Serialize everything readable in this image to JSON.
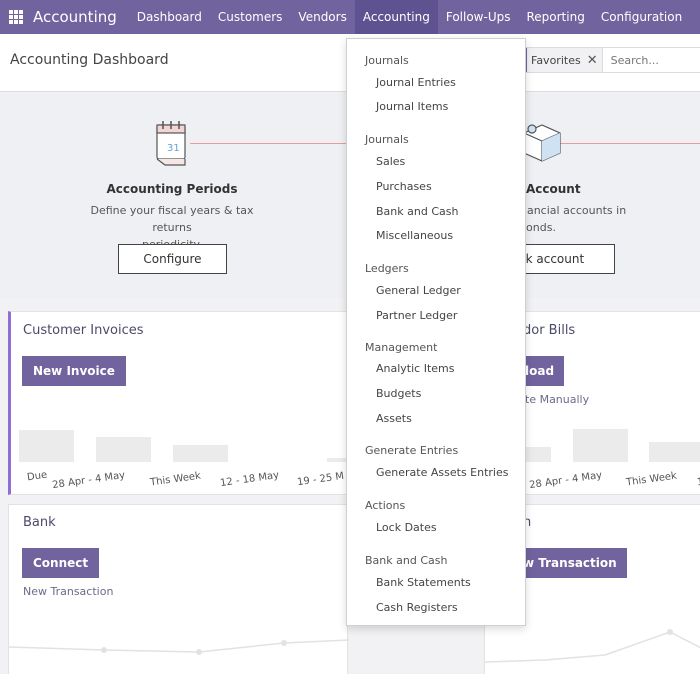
{
  "navbar": {
    "brand": "Accounting",
    "items": [
      {
        "label": "Dashboard"
      },
      {
        "label": "Customers"
      },
      {
        "label": "Vendors"
      },
      {
        "label": "Accounting"
      },
      {
        "label": "Follow-Ups"
      },
      {
        "label": "Reporting"
      },
      {
        "label": "Configuration"
      }
    ]
  },
  "control_panel": {
    "title": "Accounting Dashboard",
    "facet": "Favorites",
    "search_placeholder": "Search..."
  },
  "onboarding": {
    "periods": {
      "title": "Accounting Periods",
      "desc_line1": "Define your fiscal years & tax returns",
      "desc_line2": "periodicity.",
      "button": "Configure"
    },
    "bank": {
      "title": "Account",
      "desc_line1": "nancial accounts in",
      "desc_line2": "conds.",
      "button": "nk account"
    }
  },
  "invoices_card": {
    "title": "Customer Invoices",
    "button": "New Invoice",
    "x_labels": [
      "Due",
      "28 Apr - 4 May",
      "This Week",
      "12 - 18 May",
      "19 - 25 M"
    ]
  },
  "bills_card": {
    "title": "dor Bills",
    "button": "load",
    "link": "te Manually",
    "x_labels": [
      "28 Apr - 4 May",
      "This Week",
      "1"
    ]
  },
  "bank_card": {
    "title": "Bank",
    "button": "Connect",
    "link": "New Transaction"
  },
  "cash_card": {
    "title": "h",
    "button": "w Transaction"
  },
  "accounting_menu": {
    "sections": [
      {
        "header": "Journals",
        "items": [
          "Journal Entries",
          "Journal Items"
        ]
      },
      {
        "header": "Journals",
        "items": [
          "Sales",
          "Purchases",
          "Bank and Cash",
          "Miscellaneous"
        ]
      },
      {
        "header": "Ledgers",
        "items": [
          "General Ledger",
          "Partner Ledger"
        ]
      },
      {
        "header": "Management",
        "items": [
          "Analytic Items",
          "Budgets",
          "Assets"
        ]
      },
      {
        "header": "Generate Entries",
        "items": [
          "Generate Assets Entries"
        ]
      },
      {
        "header": "Actions",
        "items": [
          "Lock Dates"
        ]
      },
      {
        "header": "Bank and Cash",
        "items": [
          "Bank Statements",
          "Cash Registers"
        ]
      }
    ]
  }
}
